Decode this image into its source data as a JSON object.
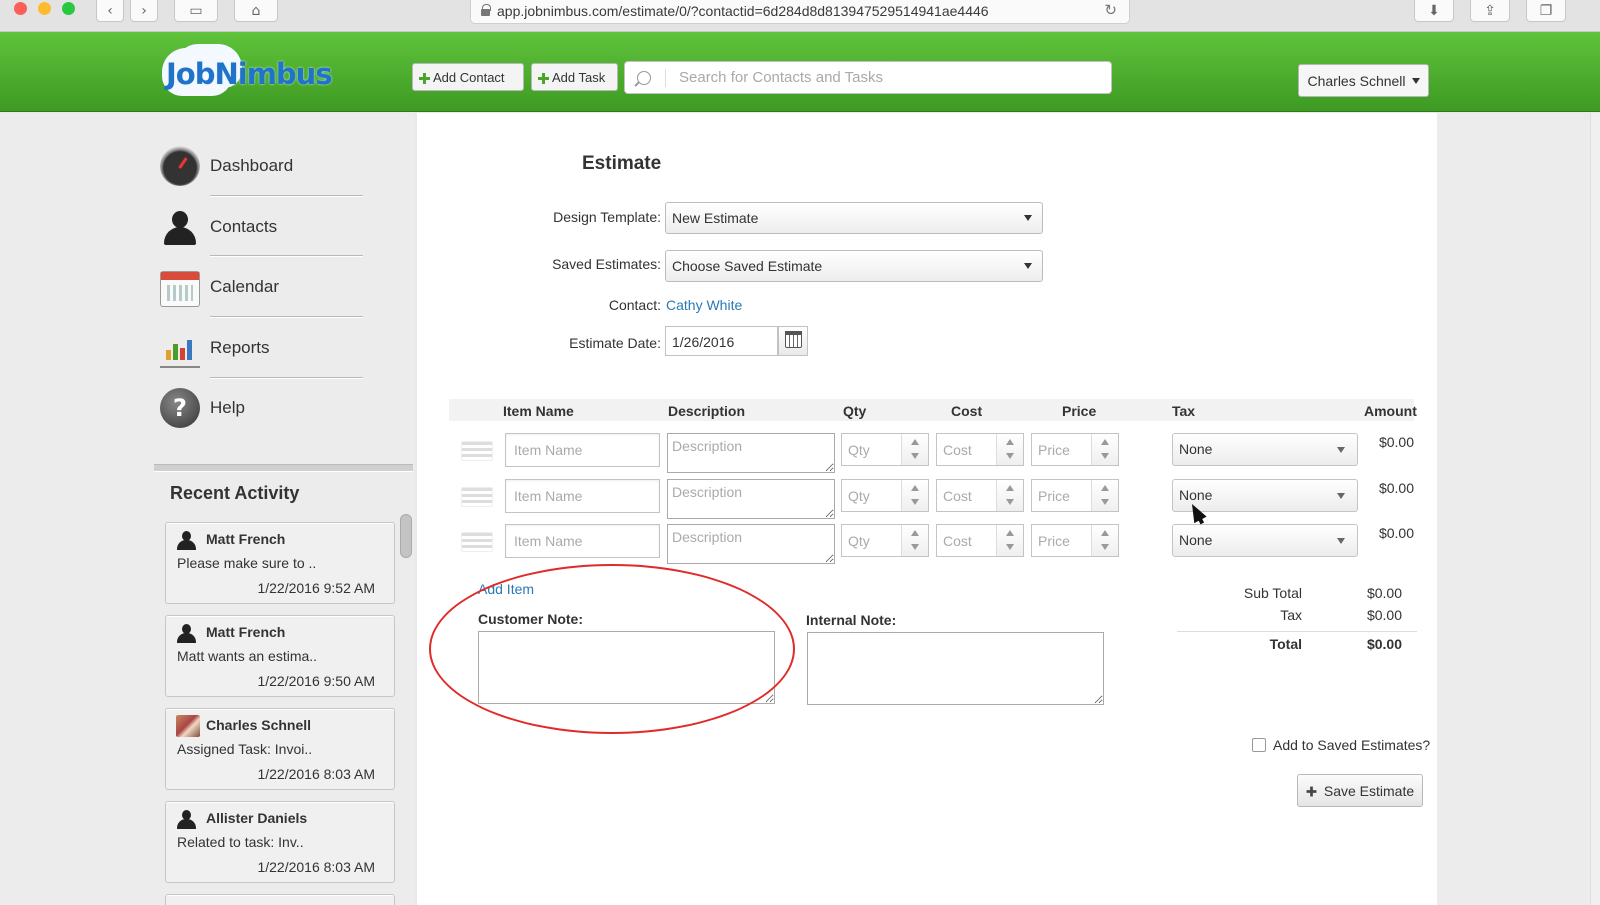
{
  "browser": {
    "url": "app.jobnimbus.com/estimate/0/?contactid=6d284d8d813947529514941ae4446"
  },
  "header": {
    "logo_part1": "Job",
    "logo_part2": "Nimbus",
    "add_contact_label": "Add Contact",
    "add_task_label": "Add Task",
    "search_placeholder": "Search for Contacts and Tasks",
    "user_name": "Charles Schnell"
  },
  "sidebar": {
    "nav": [
      {
        "label": "Dashboard",
        "icon": "dashboard-icon"
      },
      {
        "label": "Contacts",
        "icon": "contacts-icon"
      },
      {
        "label": "Calendar",
        "icon": "calendar-icon"
      },
      {
        "label": "Reports",
        "icon": "reports-icon"
      },
      {
        "label": "Help",
        "icon": "help-icon"
      }
    ],
    "recent_title": "Recent Activity",
    "activity": [
      {
        "name": "Matt French",
        "text": "Please make sure to ..",
        "date": "1/22/2016 9:52 AM"
      },
      {
        "name": "Matt French",
        "text": "Matt wants an estima..",
        "date": "1/22/2016 9:50 AM"
      },
      {
        "name": "Charles Schnell",
        "text": "Assigned Task: Invoi..",
        "date": "1/22/2016 8:03 AM"
      },
      {
        "name": "Allister Daniels",
        "text": "Related to task: Inv..",
        "date": "1/22/2016 8:03 AM"
      }
    ]
  },
  "estimate": {
    "title": "Estimate",
    "design_template_label": "Design Template:",
    "design_template_value": "New Estimate",
    "saved_estimates_label": "Saved Estimates:",
    "saved_estimates_value": "Choose Saved Estimate",
    "contact_label": "Contact:",
    "contact_value": "Cathy White",
    "date_label": "Estimate Date:",
    "date_value": "1/26/2016",
    "columns": {
      "item_name": "Item Name",
      "description": "Description",
      "qty": "Qty",
      "cost": "Cost",
      "price": "Price",
      "tax": "Tax",
      "amount": "Amount"
    },
    "placeholders": {
      "item_name": "Item Name",
      "description": "Description",
      "qty": "Qty",
      "cost": "Cost",
      "price": "Price"
    },
    "rows": [
      {
        "tax": "None",
        "amount": "$0.00"
      },
      {
        "tax": "None",
        "amount": "$0.00"
      },
      {
        "tax": "None",
        "amount": "$0.00"
      }
    ],
    "add_item_label": "Add Item",
    "customer_note_label": "Customer Note:",
    "internal_note_label": "Internal Note:",
    "subtotal_label": "Sub Total",
    "subtotal_value": "$0.00",
    "tax_label": "Tax",
    "tax_value": "$0.00",
    "total_label": "Total",
    "total_value": "$0.00",
    "add_saved_label": "Add to Saved Estimates?",
    "save_label": "Save Estimate"
  },
  "colors": {
    "header_green": "#4caf2e",
    "link_blue": "#2b79b3",
    "annotation_red": "#e02b2b"
  }
}
